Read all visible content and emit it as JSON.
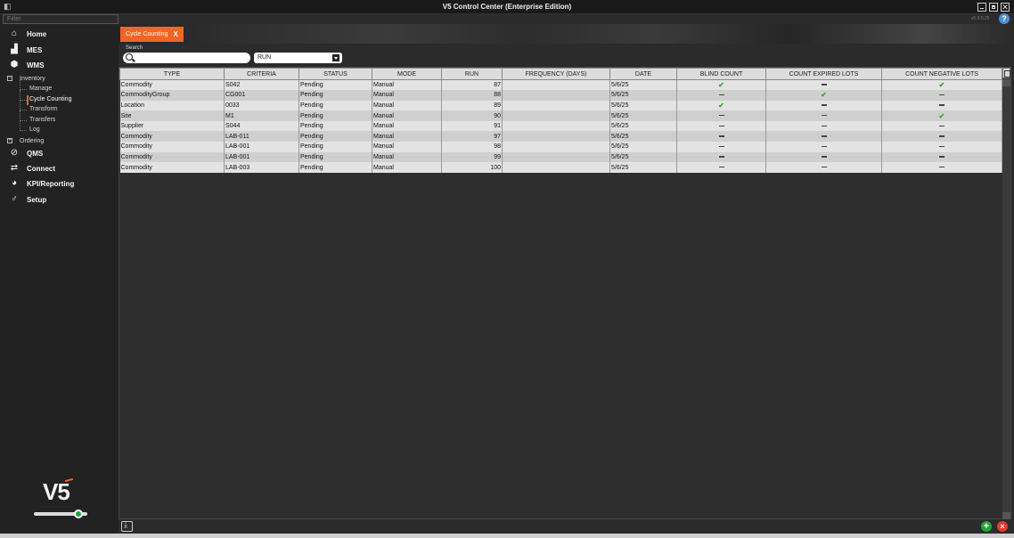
{
  "window": {
    "title": "V5 Control Center (Enterprise Edition)",
    "version": "v5.9.5.25"
  },
  "sidebar": {
    "filter_placeholder": "Filter",
    "main_items": [
      {
        "label": "Home",
        "icon": "home-icon"
      },
      {
        "label": "MES",
        "icon": "chart-icon"
      },
      {
        "label": "WMS",
        "icon": "box-icon"
      }
    ],
    "inventory": {
      "label": "Inventory",
      "expander": "−",
      "children": [
        "Manage",
        "Cycle Counting",
        "Transform",
        "Transfers",
        "Log"
      ],
      "active": "Cycle Counting"
    },
    "ordering": {
      "label": "Ordering",
      "expander": "+"
    },
    "lower_items": [
      {
        "label": "QMS",
        "icon": "check-circle-icon"
      },
      {
        "label": "Connect",
        "icon": "plug-icon"
      },
      {
        "label": "KPI/Reporting",
        "icon": "pie-chart-icon"
      },
      {
        "label": "Setup",
        "icon": "wrench-icon"
      }
    ],
    "logo_text": "V5"
  },
  "tab": {
    "label": "Cycle Counting",
    "close": "X"
  },
  "search": {
    "label": "Search",
    "field_value": "RUN"
  },
  "table": {
    "columns": [
      "TYPE",
      "CRITERIA",
      "STATUS",
      "MODE",
      "RUN",
      "FREQUENCY (DAYS)",
      "DATE",
      "BLIND COUNT",
      "COUNT EXPIRED LOTS",
      "COUNT NEGATIVE LOTS"
    ],
    "rows": [
      {
        "type": "Commodity",
        "criteria": "S042",
        "status": "Pending",
        "mode": "Manual",
        "run": "87",
        "frequency": "",
        "date": "5/6/25",
        "blind": true,
        "expired": false,
        "negative": true
      },
      {
        "type": "CommodityGroup",
        "criteria": "CG001",
        "status": "Pending",
        "mode": "Manual",
        "run": "88",
        "frequency": "",
        "date": "5/6/25",
        "blind": false,
        "expired": true,
        "negative": false
      },
      {
        "type": "Location",
        "criteria": "0033",
        "status": "Pending",
        "mode": "Manual",
        "run": "89",
        "frequency": "",
        "date": "5/6/25",
        "blind": true,
        "expired": false,
        "negative": false
      },
      {
        "type": "Site",
        "criteria": "M1",
        "status": "Pending",
        "mode": "Manual",
        "run": "90",
        "frequency": "",
        "date": "5/6/25",
        "blind": false,
        "expired": false,
        "negative": true
      },
      {
        "type": "Supplier",
        "criteria": "S044",
        "status": "Pending",
        "mode": "Manual",
        "run": "91",
        "frequency": "",
        "date": "5/6/25",
        "blind": false,
        "expired": false,
        "negative": false
      },
      {
        "type": "Commodity",
        "criteria": "LAB-011",
        "status": "Pending",
        "mode": "Manual",
        "run": "97",
        "frequency": "",
        "date": "5/6/25",
        "blind": false,
        "expired": false,
        "negative": false
      },
      {
        "type": "Commodity",
        "criteria": "LAB-001",
        "status": "Pending",
        "mode": "Manual",
        "run": "98",
        "frequency": "",
        "date": "5/6/25",
        "blind": false,
        "expired": false,
        "negative": false
      },
      {
        "type": "Commodity",
        "criteria": "LAB-001",
        "status": "Pending",
        "mode": "Manual",
        "run": "99",
        "frequency": "",
        "date": "5/6/25",
        "blind": false,
        "expired": false,
        "negative": false
      },
      {
        "type": "Commodity",
        "criteria": "LAB-003",
        "status": "Pending",
        "mode": "Manual",
        "run": "100",
        "frequency": "",
        "date": "5/6/25",
        "blind": false,
        "expired": false,
        "negative": false
      }
    ]
  },
  "footer": {
    "add": "+",
    "cancel": "×"
  },
  "colors": {
    "accent": "#f26522",
    "check": "#3ea12f",
    "add": "#21a538",
    "cancel": "#e53b2c"
  }
}
